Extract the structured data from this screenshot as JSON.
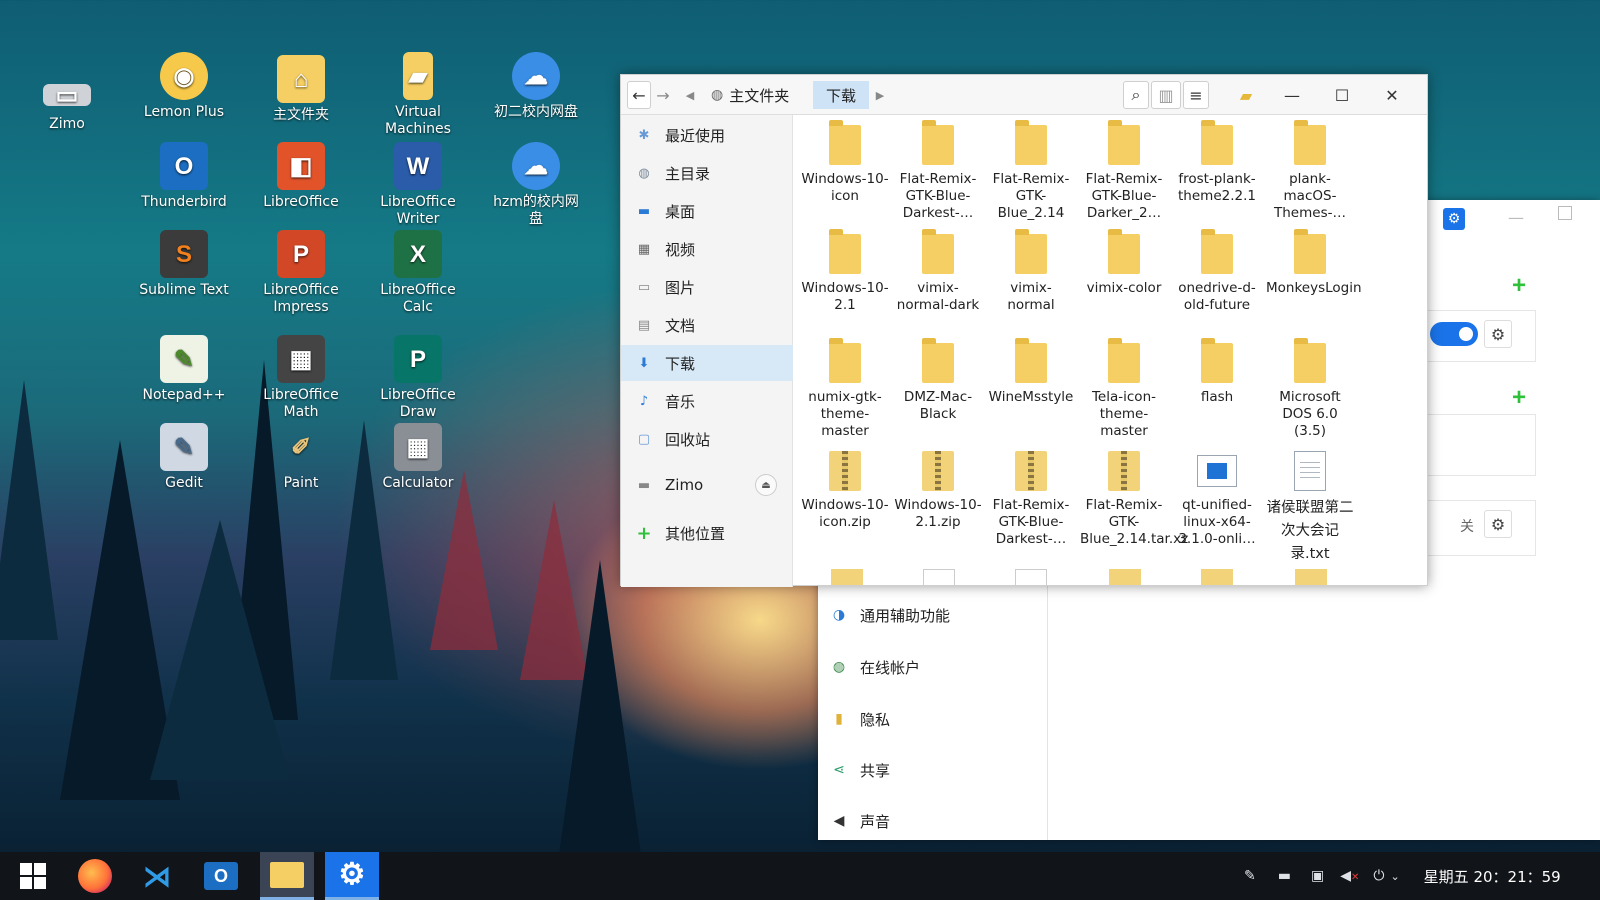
{
  "desktop": {
    "icons": [
      {
        "label": "Zimo",
        "icon": "drive-icon",
        "color": "#cfd3d8"
      },
      {
        "label": "Lemon Plus",
        "icon": "lemon-icon",
        "color": "#f6c94a"
      },
      {
        "label": "主文件夹",
        "icon": "home-folder-icon",
        "color": "#f5cf63"
      },
      {
        "label": "Virtual Machines",
        "icon": "folder-icon",
        "color": "#f5cf63"
      },
      {
        "label": "初二校内网盘",
        "icon": "network-drive-icon",
        "color": "#3a8ee6"
      },
      {
        "label": "Thunderbird",
        "icon": "outlook-icon",
        "color": "#1b6ec2"
      },
      {
        "label": "LibreOffice",
        "icon": "office-icon",
        "color": "#e2532a"
      },
      {
        "label": "LibreOffice Writer",
        "icon": "word-icon",
        "color": "#2a5caa"
      },
      {
        "label": "hzm的校内网盘",
        "icon": "network-drive-icon",
        "color": "#3a8ee6"
      },
      {
        "label": "Sublime Text",
        "icon": "sublime-icon",
        "color": "#f2811d"
      },
      {
        "label": "LibreOffice Impress",
        "icon": "powerpoint-icon",
        "color": "#d24726"
      },
      {
        "label": "LibreOffice Calc",
        "icon": "excel-icon",
        "color": "#1e7145"
      },
      {
        "label": "Notepad++",
        "icon": "notepad-icon",
        "color": "#7cb342"
      },
      {
        "label": "LibreOffice Math",
        "icon": "calculator-icon",
        "color": "#444444"
      },
      {
        "label": "LibreOffice Draw",
        "icon": "publisher-icon",
        "color": "#077568"
      },
      {
        "label": "Gedit",
        "icon": "gedit-icon",
        "color": "#cfd8e3"
      },
      {
        "label": "Paint",
        "icon": "paint-icon",
        "color": "#c8a063"
      },
      {
        "label": "Calculator",
        "icon": "calculator-icon",
        "color": "#8a8f96"
      }
    ],
    "glyphs": [
      "▭",
      "◉",
      "⌂",
      "▰",
      "☁",
      "O",
      "◧",
      "W",
      "☁",
      "S",
      "P",
      "X",
      "✎",
      "▦",
      "P",
      "✎",
      "✐",
      "▦"
    ]
  },
  "file_manager": {
    "breadcrumbs": [
      "主文件夹",
      "下载"
    ],
    "sidebar": [
      {
        "label": "最近使用",
        "icon": "recent-icon"
      },
      {
        "label": "主目录",
        "icon": "home-icon"
      },
      {
        "label": "桌面",
        "icon": "desktop-icon"
      },
      {
        "label": "视频",
        "icon": "video-icon"
      },
      {
        "label": "图片",
        "icon": "picture-icon"
      },
      {
        "label": "文档",
        "icon": "document-icon"
      },
      {
        "label": "下载",
        "icon": "download-icon"
      },
      {
        "label": "音乐",
        "icon": "music-icon"
      },
      {
        "label": "回收站",
        "icon": "trash-icon"
      },
      {
        "label": "Zimo",
        "icon": "drive-icon"
      },
      {
        "label": "其他位置",
        "icon": "plus-icon"
      }
    ],
    "files": [
      {
        "name": "Windows-10-icon",
        "type": "folder"
      },
      {
        "name": "Flat-Remix-GTK-Blue-Darkest-…",
        "type": "folder"
      },
      {
        "name": "Flat-Remix-GTK-Blue_2.14",
        "type": "folder"
      },
      {
        "name": "Flat-Remix-GTK-Blue-Darker_2…",
        "type": "folder"
      },
      {
        "name": "frost-plank-theme2.2.1",
        "type": "folder"
      },
      {
        "name": "plank-macOS-Themes-…",
        "type": "folder"
      },
      {
        "name": "Windows-10-2.1",
        "type": "folder"
      },
      {
        "name": "vimix-normal-dark",
        "type": "folder"
      },
      {
        "name": "vimix-normal",
        "type": "folder"
      },
      {
        "name": "vimix-color",
        "type": "folder"
      },
      {
        "name": "onedrive-d-old-future",
        "type": "folder"
      },
      {
        "name": "MonkeysLogin",
        "type": "folder"
      },
      {
        "name": "numix-gtk-theme-master",
        "type": "folder"
      },
      {
        "name": "DMZ-Mac-Black",
        "type": "folder"
      },
      {
        "name": "WineMsstyle",
        "type": "folder"
      },
      {
        "name": "Tela-icon-theme-master",
        "type": "folder"
      },
      {
        "name": "flash",
        "type": "folder"
      },
      {
        "name": "Microsoft DOS 6.0 (3.5)",
        "type": "folder"
      },
      {
        "name": "Windows-10-icon.zip",
        "type": "zip"
      },
      {
        "name": "Windows-10-2.1.zip",
        "type": "zip"
      },
      {
        "name": "Flat-Remix-GTK-Blue-Darkest-…",
        "type": "zip"
      },
      {
        "name": "Flat-Remix-GTK-Blue_2.14.tar.xz",
        "type": "zip"
      },
      {
        "name": "qt-unified-linux-x64-3.1.0-onli…",
        "type": "app"
      },
      {
        "name": "诸侯联盟第二次大会记录.txt",
        "type": "text"
      }
    ]
  },
  "settings": {
    "items": [
      {
        "label": "通用辅助功能",
        "icon": "accessibility-icon"
      },
      {
        "label": "在线帐户",
        "icon": "online-accounts-icon"
      },
      {
        "label": "隐私",
        "icon": "privacy-icon"
      },
      {
        "label": "共享",
        "icon": "share-icon"
      },
      {
        "label": "声音",
        "icon": "sound-icon"
      }
    ],
    "off_label": "关"
  },
  "taskbar": {
    "apps": [
      {
        "name": "start-button",
        "icon": "windows-icon"
      },
      {
        "name": "firefox",
        "icon": "firefox-icon"
      },
      {
        "name": "vscode",
        "icon": "vscode-icon"
      },
      {
        "name": "thunderbird",
        "icon": "outlook-icon"
      },
      {
        "name": "files",
        "icon": "files-icon",
        "active": true
      },
      {
        "name": "settings",
        "icon": "gear-icon",
        "active": true
      }
    ],
    "clock": "星期五 20：21：59"
  },
  "colors": {
    "accent": "#1a73e8",
    "folder": "#f5cf63",
    "selection": "#d7e8f7",
    "taskbar": "#111418",
    "plus": "#2fc13a"
  }
}
